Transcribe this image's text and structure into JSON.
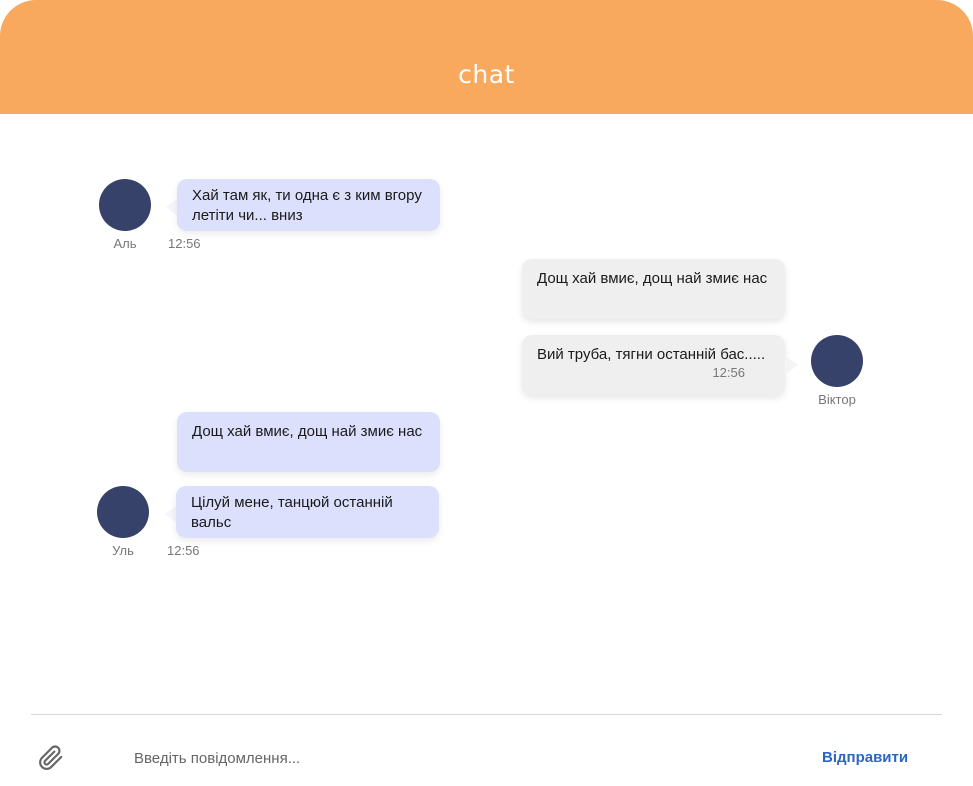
{
  "header": {
    "title": "chat"
  },
  "messages": [
    {
      "sender": "Аль",
      "text": "Хай там як, ти одна є з ким вгору летіти чи... вниз",
      "time": "12:56"
    },
    {
      "text": "Дощ хай вмиє, дощ най змиє нас"
    },
    {
      "sender": "Віктор",
      "text": "Вий труба, тягни останній бас.....",
      "time": "12:56"
    },
    {
      "text": "Дощ хай вмиє, дощ най змиє нас"
    },
    {
      "sender": "Уль",
      "text": "Цілуй мене, танцюй останній вальс",
      "time": "12:56"
    }
  ],
  "composer": {
    "attach_icon": "paperclip-icon",
    "placeholder": "Введіть повідомлення...",
    "send_label": "Відправити"
  },
  "colors": {
    "header": "#f8a95e",
    "incoming_bubble": "#dce0fc",
    "outgoing_bubble": "#efefef",
    "avatar": "#37426a",
    "send": "#2a67c4"
  }
}
